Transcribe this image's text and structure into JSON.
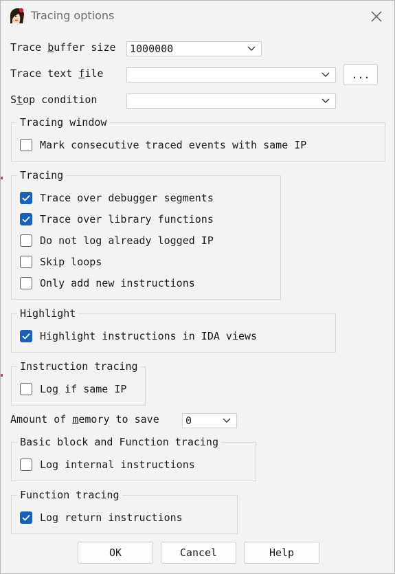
{
  "window": {
    "title": "Tracing options",
    "close_glyph": "✕"
  },
  "buffer": {
    "label_pre": "Trace ",
    "label_key": "b",
    "label_post": "uffer size",
    "value": "1000000"
  },
  "textfile": {
    "label_pre": "Trace text ",
    "label_key": "f",
    "label_post": "ile",
    "value": "",
    "browse": "..."
  },
  "stop": {
    "label_pre": "S",
    "label_key": "t",
    "label_post": "op condition",
    "value": ""
  },
  "tracing_window": {
    "legend": "Tracing window",
    "items": [
      {
        "label": "Mark consecutive traced events with same IP",
        "checked": false
      }
    ]
  },
  "tracing": {
    "legend": "Tracing",
    "items": [
      {
        "label": "Trace over debugger segments",
        "checked": true
      },
      {
        "label": "Trace over library functions",
        "checked": true
      },
      {
        "label": "Do not log already logged IP",
        "checked": false
      },
      {
        "label": "Skip loops",
        "checked": false
      },
      {
        "label": "Only add new instructions",
        "checked": false
      }
    ]
  },
  "highlight": {
    "legend": "Highlight",
    "items": [
      {
        "label": "Highlight instructions in IDA views",
        "checked": true
      }
    ]
  },
  "instruction_tracing": {
    "legend": "Instruction tracing",
    "items": [
      {
        "label": "Log if same IP",
        "checked": false
      }
    ]
  },
  "memory": {
    "label_pre": "Amount of ",
    "label_key": "m",
    "label_post": "emory to save",
    "value": "0"
  },
  "bb_function_tracing": {
    "legend": "Basic block and Function tracing",
    "items": [
      {
        "label": "Log internal instructions",
        "checked": false
      }
    ]
  },
  "function_tracing": {
    "legend": "Function tracing",
    "items": [
      {
        "label": "Log return instructions",
        "checked": true
      }
    ]
  },
  "buttons": {
    "ok": "OK",
    "cancel": "Cancel",
    "help": "Help"
  },
  "colors": {
    "accent": "#1a62b9",
    "background": "#f3f3f3"
  }
}
